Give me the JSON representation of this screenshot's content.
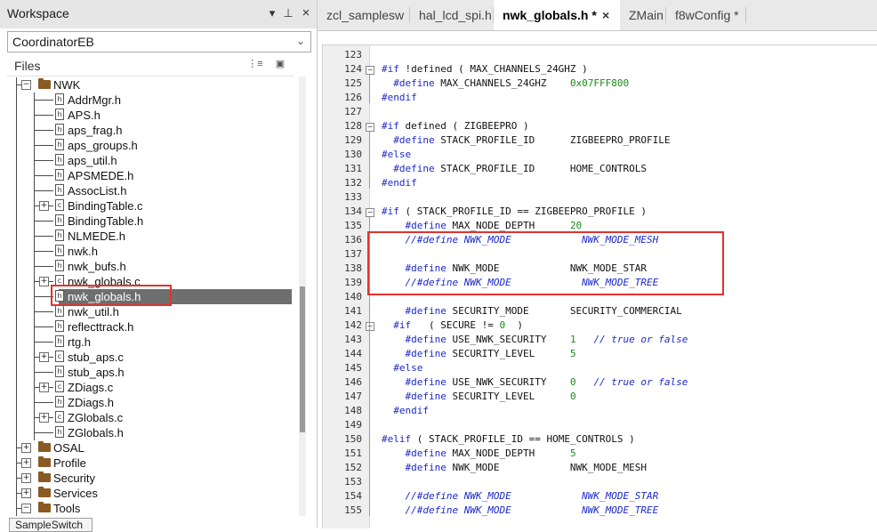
{
  "workspace": {
    "title": "Workspace",
    "pin_glyph": "▾",
    "dock_glyph": "⊥",
    "close_glyph": "×",
    "config": "CoordinatorEB",
    "files_label": "Files",
    "bottom_tab": "SampleSwitch"
  },
  "tree": [
    {
      "label": "NWK",
      "type": "folder",
      "depth": 0,
      "expander": "−"
    },
    {
      "label": "AddrMgr.h",
      "type": "h",
      "depth": 1
    },
    {
      "label": "APS.h",
      "type": "h",
      "depth": 1
    },
    {
      "label": "aps_frag.h",
      "type": "h",
      "depth": 1
    },
    {
      "label": "aps_groups.h",
      "type": "h",
      "depth": 1
    },
    {
      "label": "aps_util.h",
      "type": "h",
      "depth": 1
    },
    {
      "label": "APSMEDE.h",
      "type": "h",
      "depth": 1
    },
    {
      "label": "AssocList.h",
      "type": "h",
      "depth": 1
    },
    {
      "label": "BindingTable.c",
      "type": "c",
      "depth": 1,
      "expander": "+"
    },
    {
      "label": "BindingTable.h",
      "type": "h",
      "depth": 1
    },
    {
      "label": "NLMEDE.h",
      "type": "h",
      "depth": 1
    },
    {
      "label": "nwk.h",
      "type": "h",
      "depth": 1
    },
    {
      "label": "nwk_bufs.h",
      "type": "h",
      "depth": 1
    },
    {
      "label": "nwk_globals.c",
      "type": "c",
      "depth": 1,
      "expander": "+"
    },
    {
      "label": "nwk_globals.h",
      "type": "h",
      "depth": 1,
      "selected": true
    },
    {
      "label": "nwk_util.h",
      "type": "h",
      "depth": 1
    },
    {
      "label": "reflecttrack.h",
      "type": "h",
      "depth": 1
    },
    {
      "label": "rtg.h",
      "type": "h",
      "depth": 1
    },
    {
      "label": "stub_aps.c",
      "type": "c",
      "depth": 1,
      "expander": "+"
    },
    {
      "label": "stub_aps.h",
      "type": "h",
      "depth": 1
    },
    {
      "label": "ZDiags.c",
      "type": "c",
      "depth": 1,
      "expander": "+"
    },
    {
      "label": "ZDiags.h",
      "type": "h",
      "depth": 1
    },
    {
      "label": "ZGlobals.c",
      "type": "c",
      "depth": 1,
      "expander": "+"
    },
    {
      "label": "ZGlobals.h",
      "type": "h",
      "depth": 1
    },
    {
      "label": "OSAL",
      "type": "folder",
      "depth": 0,
      "expander": "+"
    },
    {
      "label": "Profile",
      "type": "folder",
      "depth": 0,
      "expander": "+"
    },
    {
      "label": "Security",
      "type": "folder",
      "depth": 0,
      "expander": "+"
    },
    {
      "label": "Services",
      "type": "folder",
      "depth": 0,
      "expander": "+"
    },
    {
      "label": "Tools",
      "type": "folder",
      "depth": 0,
      "expander": "−"
    }
  ],
  "tabs": [
    {
      "label": "zcl_samplesw",
      "active": false
    },
    {
      "label": "hal_lcd_spi.h",
      "active": false
    },
    {
      "label": "nwk_globals.h *",
      "active": true
    },
    {
      "label": "ZMain",
      "active": false
    },
    {
      "label": "f8wConfig *",
      "active": false
    }
  ],
  "tab_close_glyph": "×",
  "code_lines": [
    {
      "n": "123",
      "fold": "",
      "parts": []
    },
    {
      "n": "124",
      "fold": "−",
      "parts": [
        [
          "kw",
          "#if "
        ],
        [
          "tok",
          "!defined ( MAX_CHANNELS_24GHZ )"
        ]
      ]
    },
    {
      "n": "125",
      "fold": "",
      "parts": [
        [
          "kw",
          "  #define "
        ],
        [
          "tok",
          "MAX_CHANNELS_24GHZ    "
        ],
        [
          "num",
          "0x07FFF800"
        ]
      ]
    },
    {
      "n": "126",
      "fold": "",
      "parts": [
        [
          "kw",
          "#endif"
        ]
      ]
    },
    {
      "n": "127",
      "fold": "",
      "parts": []
    },
    {
      "n": "128",
      "fold": "−",
      "parts": [
        [
          "kw",
          "#if "
        ],
        [
          "tok",
          "defined ( ZIGBEEPRO )"
        ]
      ]
    },
    {
      "n": "129",
      "fold": "",
      "parts": [
        [
          "kw",
          "  #define "
        ],
        [
          "tok",
          "STACK_PROFILE_ID      ZIGBEEPRO_PROFILE"
        ]
      ]
    },
    {
      "n": "130",
      "fold": "",
      "parts": [
        [
          "kw",
          "#else"
        ]
      ]
    },
    {
      "n": "131",
      "fold": "",
      "parts": [
        [
          "kw",
          "  #define "
        ],
        [
          "tok",
          "STACK_PROFILE_ID      HOME_CONTROLS"
        ]
      ]
    },
    {
      "n": "132",
      "fold": "",
      "parts": [
        [
          "kw",
          "#endif"
        ]
      ]
    },
    {
      "n": "133",
      "fold": "",
      "parts": []
    },
    {
      "n": "134",
      "fold": "−",
      "parts": [
        [
          "kw",
          "#if "
        ],
        [
          "tok",
          "( STACK_PROFILE_ID == ZIGBEEPRO_PROFILE )"
        ]
      ]
    },
    {
      "n": "135",
      "fold": "",
      "parts": [
        [
          "kw",
          "    #define "
        ],
        [
          "tok",
          "MAX_NODE_DEPTH      "
        ],
        [
          "num",
          "20"
        ]
      ]
    },
    {
      "n": "136",
      "fold": "",
      "parts": [
        [
          "cmt",
          "    //#define NWK_MODE            NWK_MODE_MESH"
        ]
      ]
    },
    {
      "n": "137",
      "fold": "",
      "parts": []
    },
    {
      "n": "138",
      "fold": "",
      "parts": [
        [
          "kw",
          "    #define "
        ],
        [
          "tok",
          "NWK_MODE            NWK_MODE_STAR"
        ]
      ]
    },
    {
      "n": "139",
      "fold": "",
      "parts": [
        [
          "cmt",
          "    //#define NWK_MODE            NWK_MODE_TREE"
        ]
      ]
    },
    {
      "n": "140",
      "fold": "",
      "parts": []
    },
    {
      "n": "141",
      "fold": "",
      "parts": [
        [
          "kw",
          "    #define "
        ],
        [
          "tok",
          "SECURITY_MODE       SECURITY_COMMERCIAL"
        ]
      ]
    },
    {
      "n": "142",
      "fold": "−",
      "parts": [
        [
          "kw",
          "  #if   "
        ],
        [
          "tok",
          "( SECURE != "
        ],
        [
          "num",
          "0"
        ],
        [
          "tok",
          "  )"
        ]
      ]
    },
    {
      "n": "143",
      "fold": "",
      "parts": [
        [
          "kw",
          "    #define "
        ],
        [
          "tok",
          "USE_NWK_SECURITY    "
        ],
        [
          "num",
          "1"
        ],
        [
          "tok",
          "   "
        ],
        [
          "cmt",
          "// true or false"
        ]
      ]
    },
    {
      "n": "144",
      "fold": "",
      "parts": [
        [
          "kw",
          "    #define "
        ],
        [
          "tok",
          "SECURITY_LEVEL      "
        ],
        [
          "num",
          "5"
        ]
      ]
    },
    {
      "n": "145",
      "fold": "",
      "parts": [
        [
          "kw",
          "  #else"
        ]
      ]
    },
    {
      "n": "146",
      "fold": "",
      "parts": [
        [
          "kw",
          "    #define "
        ],
        [
          "tok",
          "USE_NWK_SECURITY    "
        ],
        [
          "num",
          "0"
        ],
        [
          "tok",
          "   "
        ],
        [
          "cmt",
          "// true or false"
        ]
      ]
    },
    {
      "n": "147",
      "fold": "",
      "parts": [
        [
          "kw",
          "    #define "
        ],
        [
          "tok",
          "SECURITY_LEVEL      "
        ],
        [
          "num",
          "0"
        ]
      ]
    },
    {
      "n": "148",
      "fold": "",
      "parts": [
        [
          "kw",
          "  #endif"
        ]
      ]
    },
    {
      "n": "149",
      "fold": "",
      "parts": []
    },
    {
      "n": "150",
      "fold": "",
      "parts": [
        [
          "kw",
          "#elif "
        ],
        [
          "tok",
          "( STACK_PROFILE_ID == HOME_CONTROLS )"
        ]
      ]
    },
    {
      "n": "151",
      "fold": "",
      "parts": [
        [
          "kw",
          "    #define "
        ],
        [
          "tok",
          "MAX_NODE_DEPTH      "
        ],
        [
          "num",
          "5"
        ]
      ]
    },
    {
      "n": "152",
      "fold": "",
      "parts": [
        [
          "kw",
          "    #define "
        ],
        [
          "tok",
          "NWK_MODE            NWK_MODE_MESH"
        ]
      ]
    },
    {
      "n": "153",
      "fold": "",
      "parts": []
    },
    {
      "n": "154",
      "fold": "",
      "parts": [
        [
          "cmt",
          "    //#define NWK_MODE            NWK_MODE_STAR"
        ]
      ]
    },
    {
      "n": "155",
      "fold": "",
      "parts": [
        [
          "cmt",
          "    //#define NWK_MODE            NWK_MODE_TREE"
        ]
      ]
    }
  ],
  "colors": {
    "keyword": "#1c2ac9",
    "number": "#1a8a1a",
    "highlight": "#e0332f",
    "selection": "#6e6e6e"
  }
}
